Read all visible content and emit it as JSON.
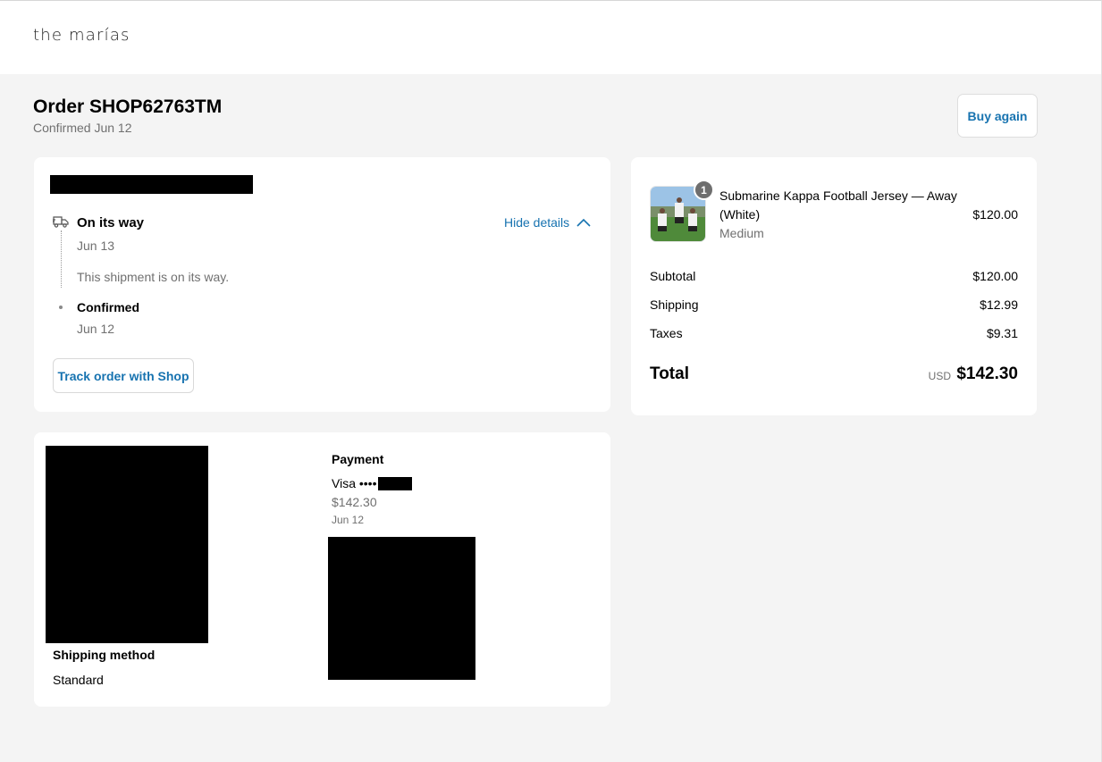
{
  "header": {
    "logo": "the marías"
  },
  "order": {
    "title": "Order SHOP62763TM",
    "subtitle": "Confirmed Jun 12",
    "buy_again_label": "Buy again"
  },
  "status": {
    "hide_details_label": "Hide details",
    "events": [
      {
        "title": "On its way",
        "date": "Jun 13",
        "description": "This shipment is on its way."
      },
      {
        "title": "Confirmed",
        "date": "Jun 12"
      }
    ],
    "track_button_label": "Track order with Shop"
  },
  "summary": {
    "item": {
      "quantity": "1",
      "name": "Submarine Kappa Football Jersey — Away (White)",
      "variant": "Medium",
      "price": "$120.00"
    },
    "rows": [
      {
        "label": "Subtotal",
        "value": "$120.00"
      },
      {
        "label": "Shipping",
        "value": "$12.99"
      },
      {
        "label": "Taxes",
        "value": "$9.31"
      }
    ],
    "total": {
      "label": "Total",
      "currency": "USD",
      "value": "$142.30"
    }
  },
  "info": {
    "payment": {
      "title": "Payment",
      "card_prefix": "Visa ••••",
      "amount": "$142.30",
      "date": "Jun 12"
    },
    "shipping_method": {
      "title": "Shipping method",
      "value": "Standard"
    }
  },
  "colors": {
    "accent": "#1773b0",
    "background": "#f4f4f4",
    "muted_text": "#707070"
  }
}
